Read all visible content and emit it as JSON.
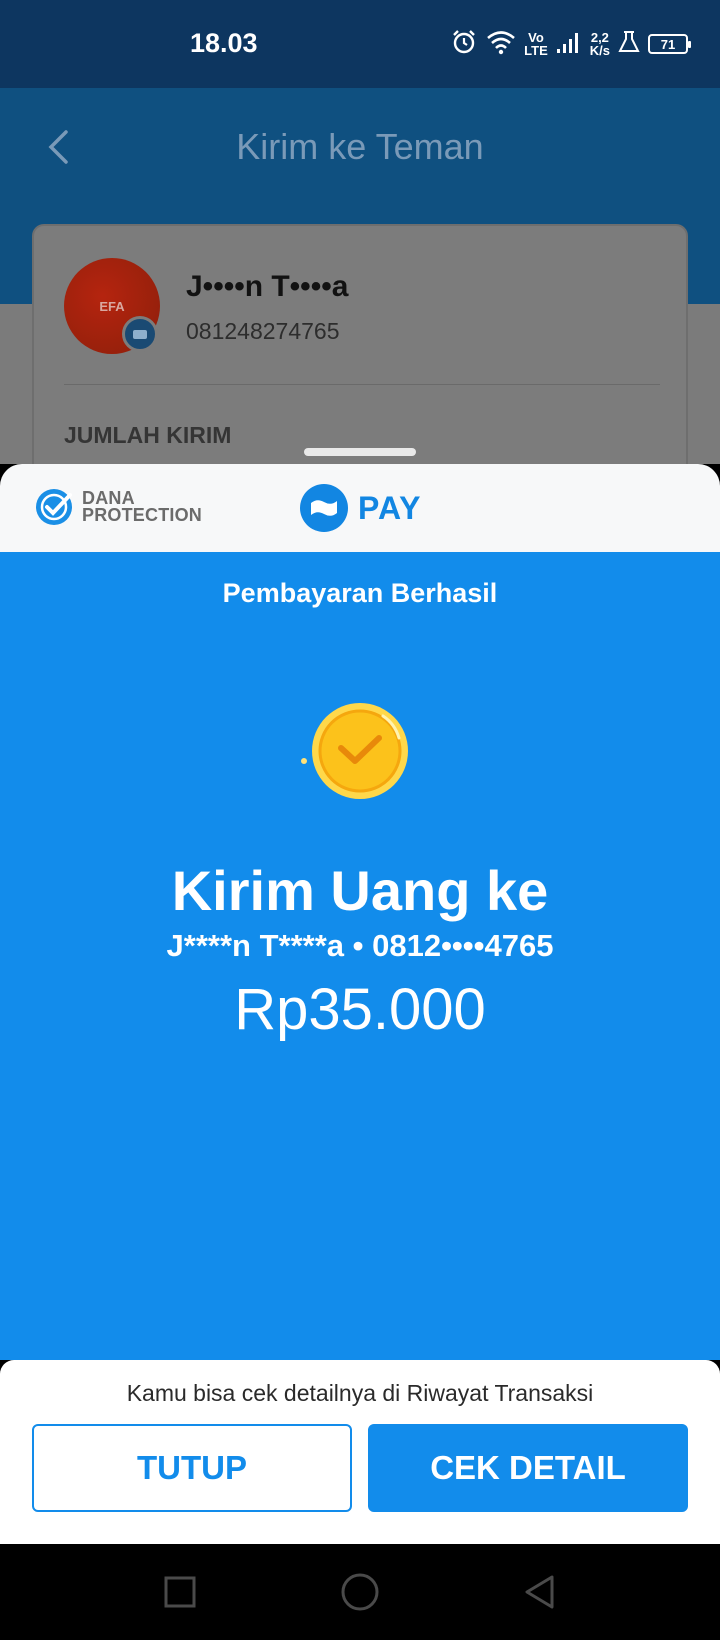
{
  "status_bar": {
    "time": "18.03",
    "network_top": "Vo",
    "network_bottom": "LTE",
    "speed_value": "2,2",
    "speed_unit": "K/s",
    "battery": "71",
    "icons": [
      "alarm-icon",
      "wifi-icon",
      "signal-icon",
      "lab-icon",
      "battery-icon"
    ]
  },
  "header": {
    "title": "Kirim ke Teman",
    "back_icon": "chevron-left-icon"
  },
  "recipient_card": {
    "avatar_text": "EFA",
    "name": "J••••n T••••a",
    "phone": "081248274765",
    "amount_label": "JUMLAH KIRIM"
  },
  "sheet": {
    "protection_line1": "DANA",
    "protection_line2": "PROTECTION",
    "pay_label": "PAY",
    "status_title": "Pembayaran Berhasil",
    "send_title": "Kirim Uang ke",
    "recipient_line": "J****n T****a • 0812••••4765",
    "amount": "Rp35.000",
    "footer_note": "Kamu bisa cek detailnya di Riwayat Transaksi",
    "close_button": "TUTUP",
    "detail_button": "CEK DETAIL"
  },
  "colors": {
    "primary": "#128ceb",
    "status_bar": "#0d3660",
    "coin": "#fcc21b"
  }
}
